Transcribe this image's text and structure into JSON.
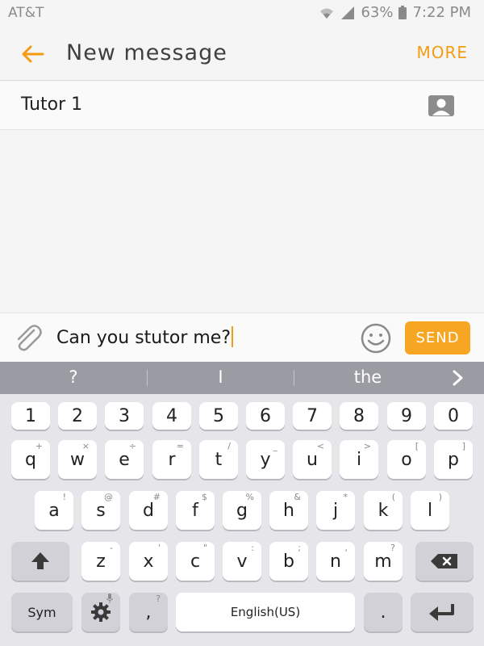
{
  "status": {
    "carrier": "AT&T",
    "battery": "63%",
    "time": "7:22 PM"
  },
  "header": {
    "title": "New message",
    "more_label": "MORE"
  },
  "recipient": {
    "name": "Tutor 1"
  },
  "compose": {
    "text": "Can you stutor me?",
    "send_label": "SEND"
  },
  "suggestions": [
    "?",
    "I",
    "the"
  ],
  "keyboard": {
    "numbers": [
      "1",
      "2",
      "3",
      "4",
      "5",
      "6",
      "7",
      "8",
      "9",
      "0"
    ],
    "row1": [
      "q",
      "w",
      "e",
      "r",
      "t",
      "y",
      "u",
      "i",
      "o",
      "p"
    ],
    "row1_hints": [
      "+",
      "×",
      "÷",
      "=",
      "/",
      "_",
      "<",
      ">",
      "[",
      "]"
    ],
    "row2": [
      "a",
      "s",
      "d",
      "f",
      "g",
      "h",
      "j",
      "k",
      "l"
    ],
    "row2_hints": [
      "!",
      "@",
      "#",
      "$",
      "%",
      "&",
      "*",
      "(",
      ")"
    ],
    "row3": [
      "z",
      "x",
      "c",
      "v",
      "b",
      "n",
      "m"
    ],
    "row3_hints": [
      "-",
      "'",
      "\"",
      ":",
      ";",
      ",",
      "?"
    ],
    "sym_label": "Sym",
    "comma": ",",
    "comma_hint": "?",
    "space_label": "English(US)",
    "period": "."
  },
  "colors": {
    "accent": "#f39c12",
    "send_bg": "#f7a623",
    "suggest_bg": "#9b9ba3",
    "keyboard_bg": "#e5e5ea"
  },
  "icons": {
    "back": "arrow-left-icon",
    "contact": "contact-card-icon",
    "attach": "paperclip-icon",
    "emoji": "smiley-icon",
    "shift": "shift-arrow-icon",
    "backspace": "backspace-icon",
    "settings": "gear-icon",
    "enter": "enter-icon",
    "wifi": "wifi-icon",
    "signal": "signal-icon",
    "battery": "battery-icon",
    "next_suggestion": "chevron-right-icon"
  }
}
